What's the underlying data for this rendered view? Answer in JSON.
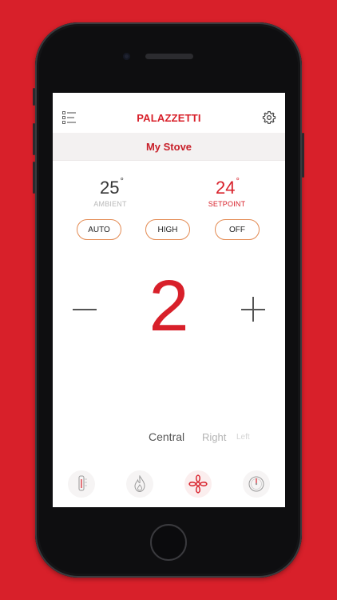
{
  "header": {
    "brand": "PALAZZETTI",
    "title": "My Stove"
  },
  "temperatures": {
    "ambient": {
      "value": "25",
      "unit": "°",
      "label": "AMBIENT"
    },
    "setpoint": {
      "value": "24",
      "unit": "°",
      "label": "SETPOINT"
    }
  },
  "modes": [
    {
      "label": "AUTO"
    },
    {
      "label": "HIGH"
    },
    {
      "label": "OFF"
    }
  ],
  "fan_level": "2",
  "directions": [
    {
      "label": "Central"
    },
    {
      "label": "Right"
    },
    {
      "label": "Left"
    }
  ],
  "bottom_nav": [
    {
      "icon": "thermostat-icon"
    },
    {
      "icon": "flame-icon"
    },
    {
      "icon": "fan-icon"
    },
    {
      "icon": "gauge-icon"
    }
  ],
  "colors": {
    "background": "#d8202a",
    "accent": "#d8202a",
    "button_border": "#e38a52"
  }
}
